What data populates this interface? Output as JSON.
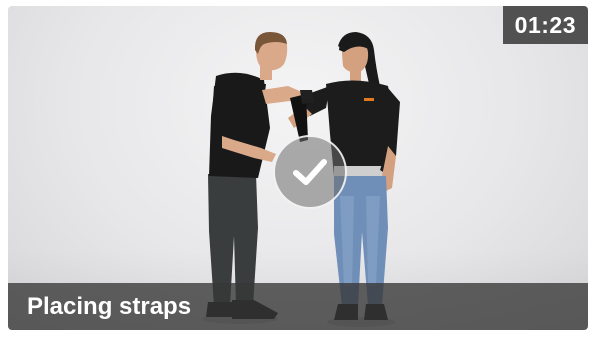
{
  "video": {
    "duration": "01:23",
    "title": "Placing straps",
    "watched": true
  },
  "icons": {
    "status": "checkmark-icon"
  }
}
